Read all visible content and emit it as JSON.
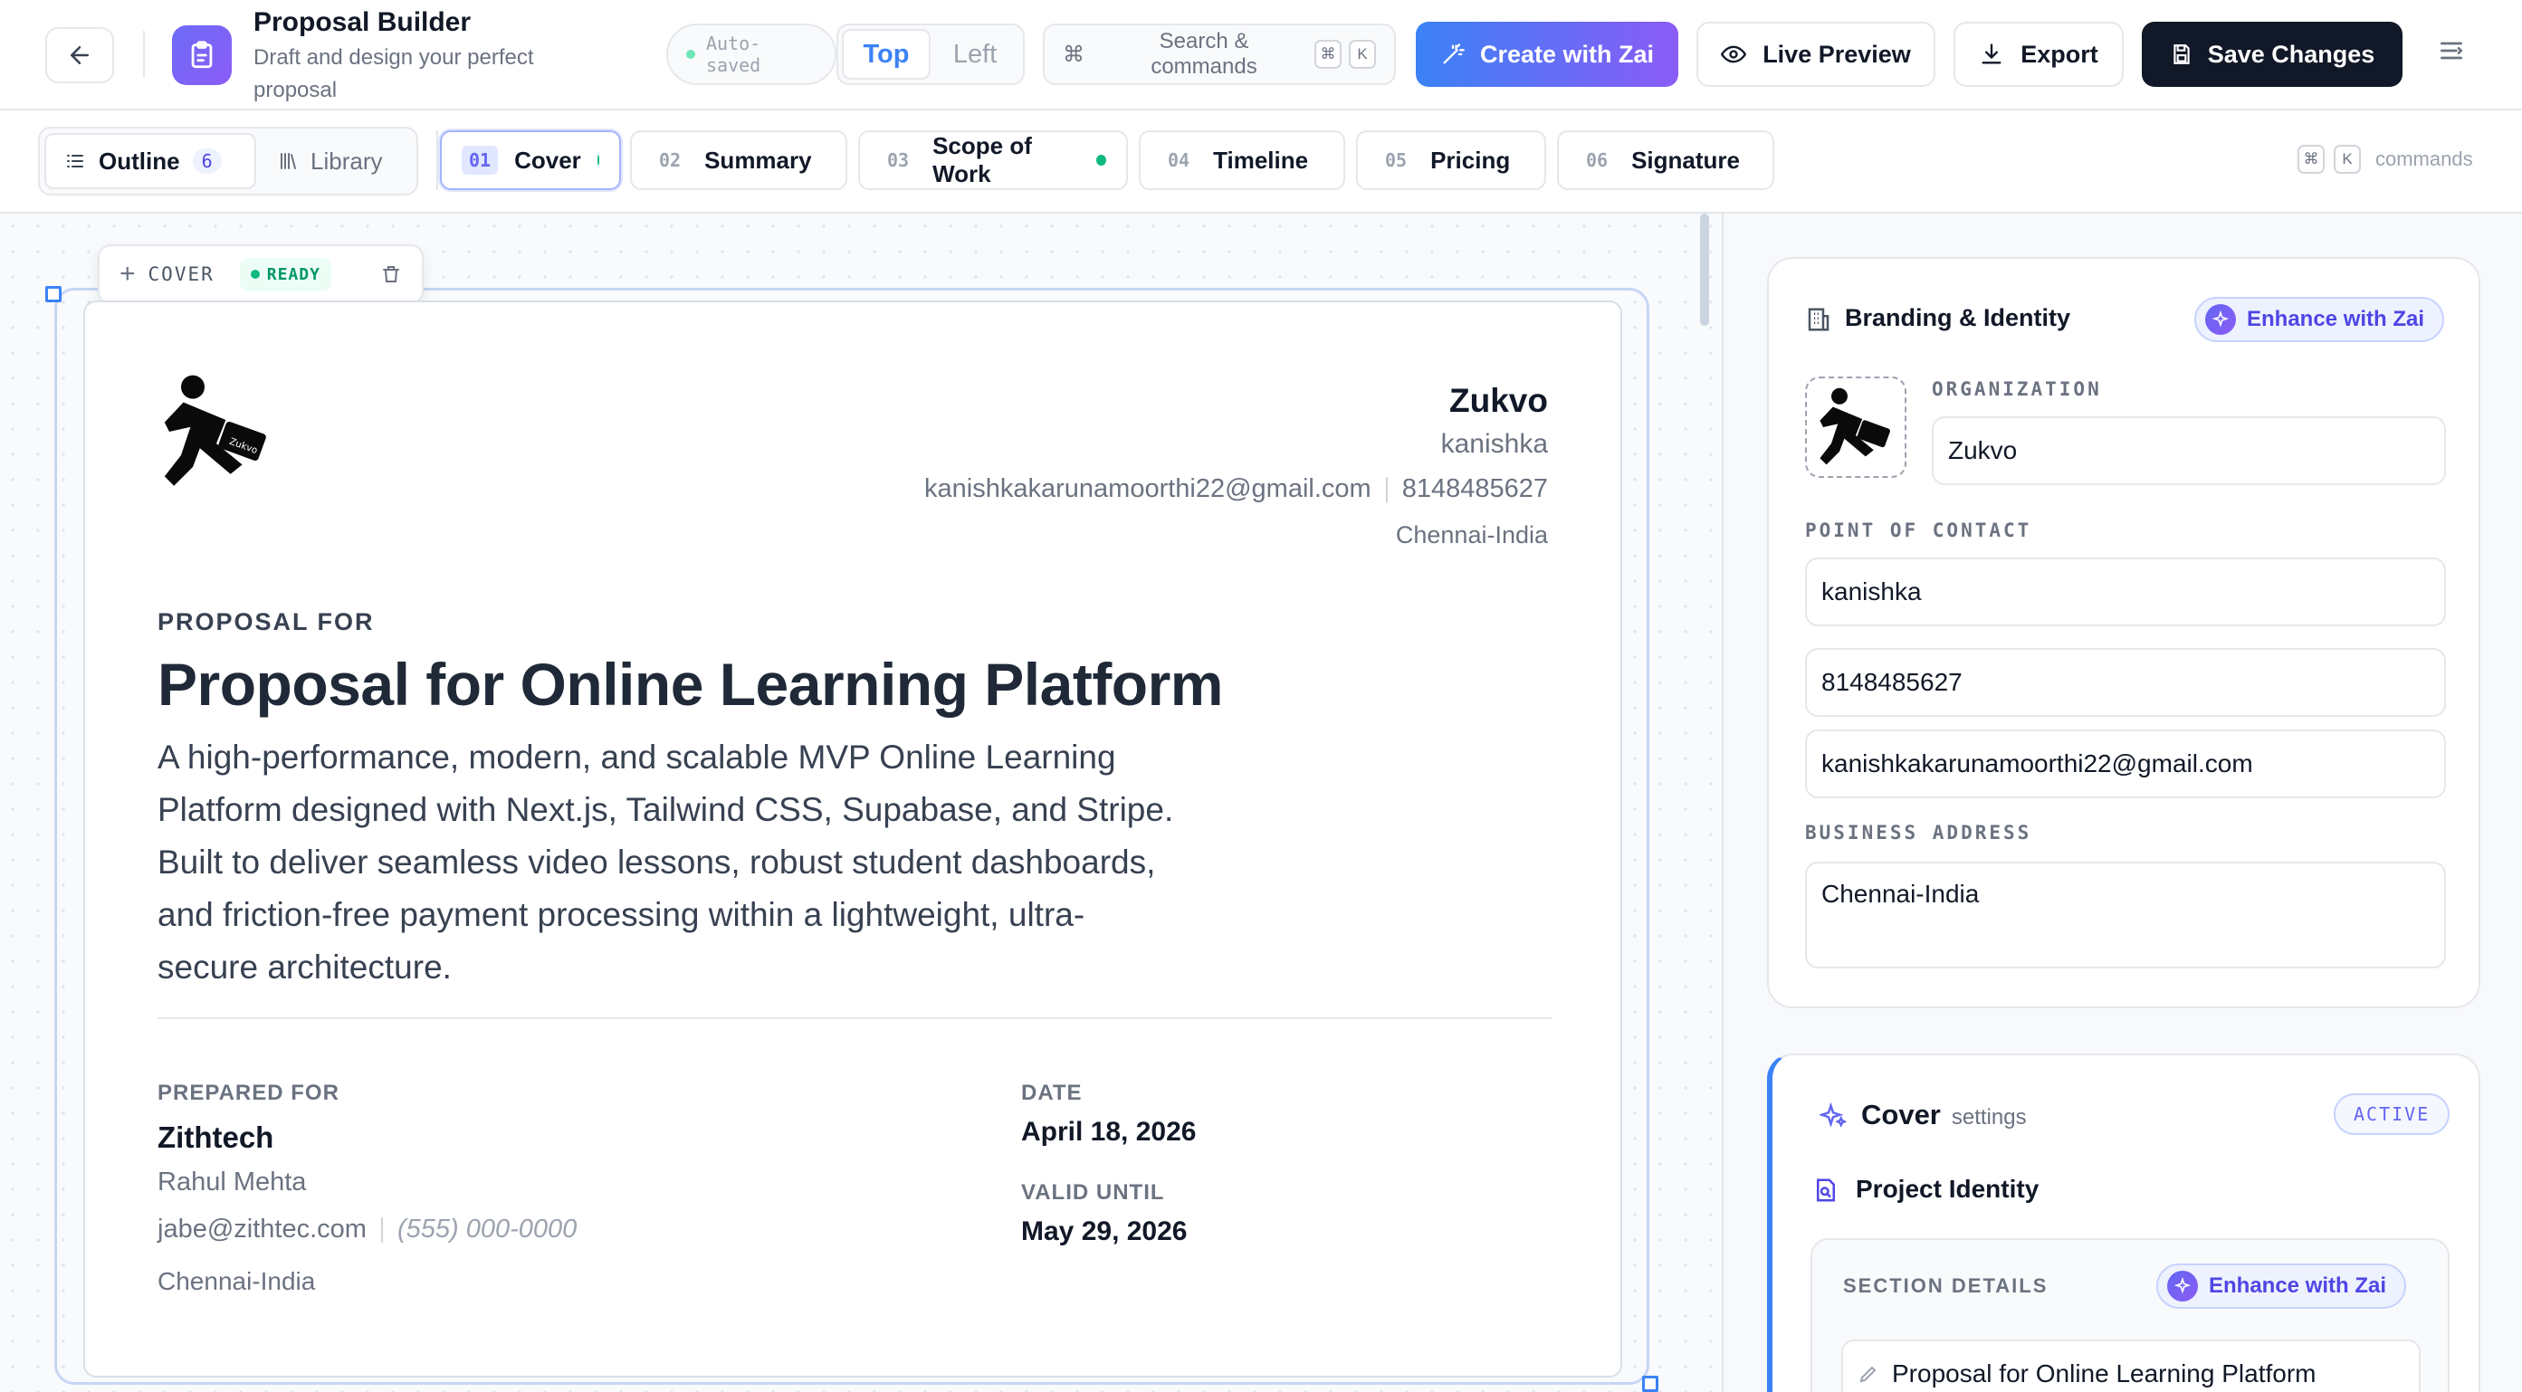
{
  "header": {
    "app_title": "Proposal Builder",
    "app_subtitle_line1": "Draft and design your perfect",
    "app_subtitle_line2": "proposal",
    "autosave_line1": "Auto-",
    "autosave_line2": "saved",
    "layout_options": [
      "Top",
      "Left"
    ],
    "layout_selected": "Top",
    "search_line1": "Search &",
    "search_line2": "commands",
    "shortcut_keys": [
      "⌘",
      "K"
    ],
    "create_label": "Create with Zai",
    "preview_label": "Live Preview",
    "export_label": "Export",
    "save_label": "Save Changes"
  },
  "tabbar": {
    "outline_label": "Outline",
    "outline_count": "6",
    "library_label": "Library",
    "sections": [
      {
        "num": "01",
        "label": "Cover",
        "status": "green"
      },
      {
        "num": "02",
        "label": "Summary",
        "status": "orange"
      },
      {
        "num": "03",
        "label": "Scope of Work",
        "status": "green"
      },
      {
        "num": "04",
        "label": "Timeline",
        "status": "green"
      },
      {
        "num": "05",
        "label": "Pricing",
        "status": "green"
      },
      {
        "num": "06",
        "label": "Signature",
        "status": "green"
      }
    ],
    "commands_label": "commands"
  },
  "block_toolbar": {
    "section_label": "COVER",
    "status_label": "READY"
  },
  "cover": {
    "org_name": "Zukvo",
    "contact_name": "kanishka",
    "email": "kanishkakarunamoorthi22@gmail.com",
    "phone": "8148485627",
    "address": "Chennai-India",
    "proposal_for_label": "PROPOSAL FOR",
    "title": "Proposal for Online Learning Platform",
    "description": [
      "A high-performance, modern, and scalable MVP Online Learning",
      "Platform designed with Next.js, Tailwind CSS, Supabase, and Stripe.",
      "Built to deliver seamless video lessons, robust student dashboards,",
      "and friction-free payment processing within a lightweight, ultra-",
      "secure architecture."
    ],
    "prepared_for_label": "PREPARED FOR",
    "client_company": "Zithtech",
    "client_name": "Rahul Mehta",
    "client_email": "jabe@zithtec.com",
    "client_phone_placeholder": "(555) 000-0000",
    "client_address": "Chennai-India",
    "date_label": "DATE",
    "date_value": "April 18, 2026",
    "valid_until_label": "VALID UNTIL",
    "valid_until_value": "May 29, 2026"
  },
  "branding": {
    "title": "Branding & Identity",
    "enhance_label": "Enhance with Zai",
    "organization_label": "ORGANIZATION",
    "organization_value": "Zukvo",
    "poc_label": "POINT OF CONTACT",
    "poc_name": "kanishka",
    "poc_phone": "8148485627",
    "poc_email": "kanishkakarunamoorthi22@gmail.com",
    "address_label": "BUSINESS ADDRESS",
    "address_value": "Chennai-India"
  },
  "cover_settings": {
    "title": "Cover",
    "subtitle": "settings",
    "badge": "ACTIVE",
    "project_identity_label": "Project Identity",
    "section_details_label": "SECTION DETAILS",
    "enhance_label": "Enhance with Zai",
    "title_field_value": "Proposal for Online Learning Platform"
  },
  "colors": {
    "accent": "#4f46e5",
    "create_gradient_start": "#3b82f6",
    "create_gradient_end": "#8b5cf6",
    "save_bg": "#111827",
    "status_green": "#10b981",
    "status_orange": "#f59e0b"
  },
  "icons": [
    "back-arrow-icon",
    "clipboard-icon",
    "command-icon",
    "magic-wand-icon",
    "eye-icon",
    "download-icon",
    "save-icon",
    "menu-icon",
    "list-icon",
    "library-icon",
    "plus-icon",
    "trash-icon",
    "building-icon",
    "sparkle-icon",
    "document-search-icon",
    "pencil-icon"
  ]
}
